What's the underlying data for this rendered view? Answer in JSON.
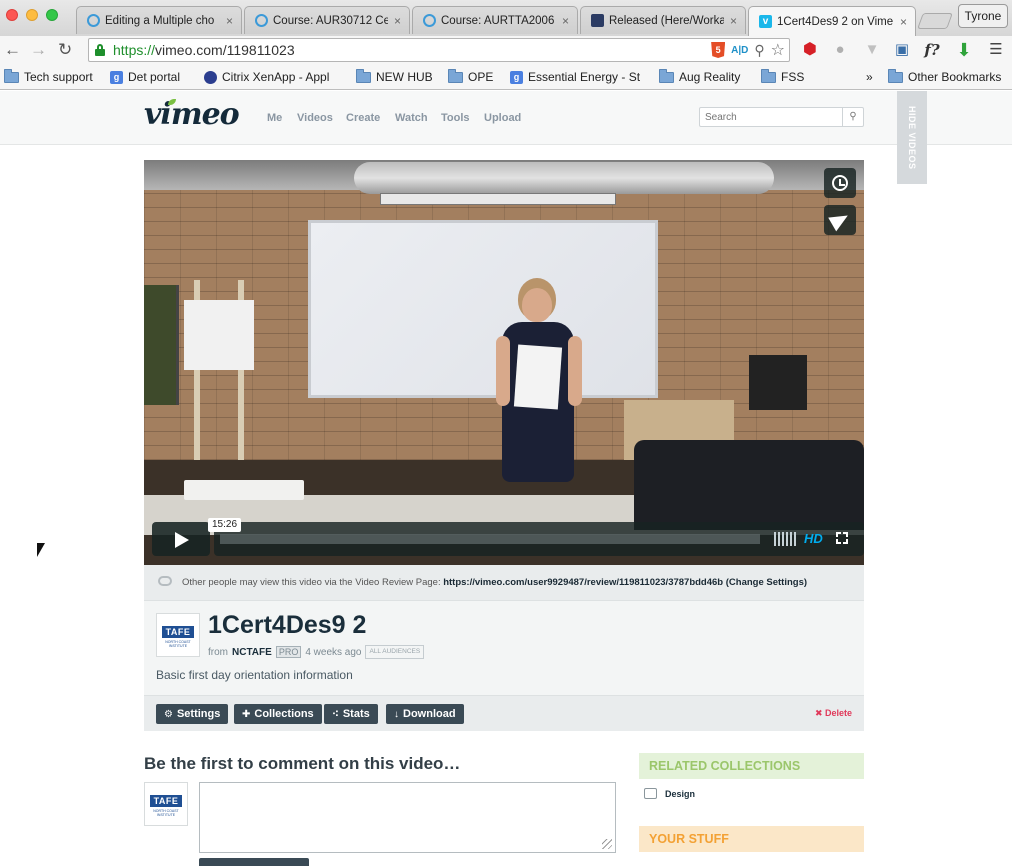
{
  "browser": {
    "tabs": [
      {
        "title": "Editing a Multiple cho"
      },
      {
        "title": "Course: AUR30712 Ce"
      },
      {
        "title": "Course: AURTTA2006"
      },
      {
        "title": "Released (Here/Worka"
      },
      {
        "title": "1Cert4Des9 2 on Vime",
        "active": true
      }
    ],
    "close_glyph": "×",
    "profile_name": "Tyrone",
    "url_scheme": "https://",
    "url_rest": "vimeo.com/119811023",
    "html5_badge": "5",
    "aid_badge": "A|D",
    "f_button": "f?",
    "bookmarks": [
      {
        "label": "Tech support",
        "icon": "folder-icon"
      },
      {
        "label": "Det portal",
        "icon": "google-icon"
      },
      {
        "label": "Citrix XenApp - Appl",
        "icon": "citrix-icon"
      },
      {
        "label": "NEW HUB",
        "icon": "folder-icon"
      },
      {
        "label": "OPE",
        "icon": "folder-icon"
      },
      {
        "label": "Essential Energy - St",
        "icon": "google-icon"
      },
      {
        "label": "Aug Reality",
        "icon": "folder-icon"
      },
      {
        "label": "FSS",
        "icon": "folder-icon"
      }
    ],
    "bookmarks_overflow": "»",
    "other_bookmarks": "Other Bookmarks",
    "google_glyph": "g"
  },
  "vimeo": {
    "logo": "vimeo",
    "nav": [
      "Me",
      "Videos",
      "Create",
      "Watch",
      "Tools",
      "Upload"
    ],
    "search_placeholder": "Search",
    "hide_videos": "HIDE VIDEOS",
    "player": {
      "timecode": "15:26",
      "quality": "HD"
    },
    "review_notice": "Other people may view this video via the Video Review Page:",
    "review_url": "https://vimeo.com/user9929487/review/119811023/3787bdd46b",
    "change_settings": "(Change Settings)",
    "video": {
      "title": "1Cert4Des9 2",
      "from_label": "from",
      "owner": "NCTAFE",
      "pro_badge": "PRO",
      "age": "4 weeks ago",
      "audience_badge": "ALL AUDIENCES",
      "description": "Basic first day orientation information"
    },
    "tafe_logo": {
      "text": "TAFE",
      "subtitle": "NORTH COAST INSTITUTE"
    },
    "actions": [
      {
        "label": "Settings",
        "icon": "⚙"
      },
      {
        "label": "Collections",
        "icon": "✚"
      },
      {
        "label": "Stats",
        "icon": "⁖"
      },
      {
        "label": "Download",
        "icon": "↓"
      }
    ],
    "delete_label": "✖ Delete",
    "comments_title": "Be the first to comment on this video…",
    "related_collections": "RELATED COLLECTIONS",
    "related_items": [
      "Design"
    ],
    "your_stuff": "YOUR STUFF"
  }
}
